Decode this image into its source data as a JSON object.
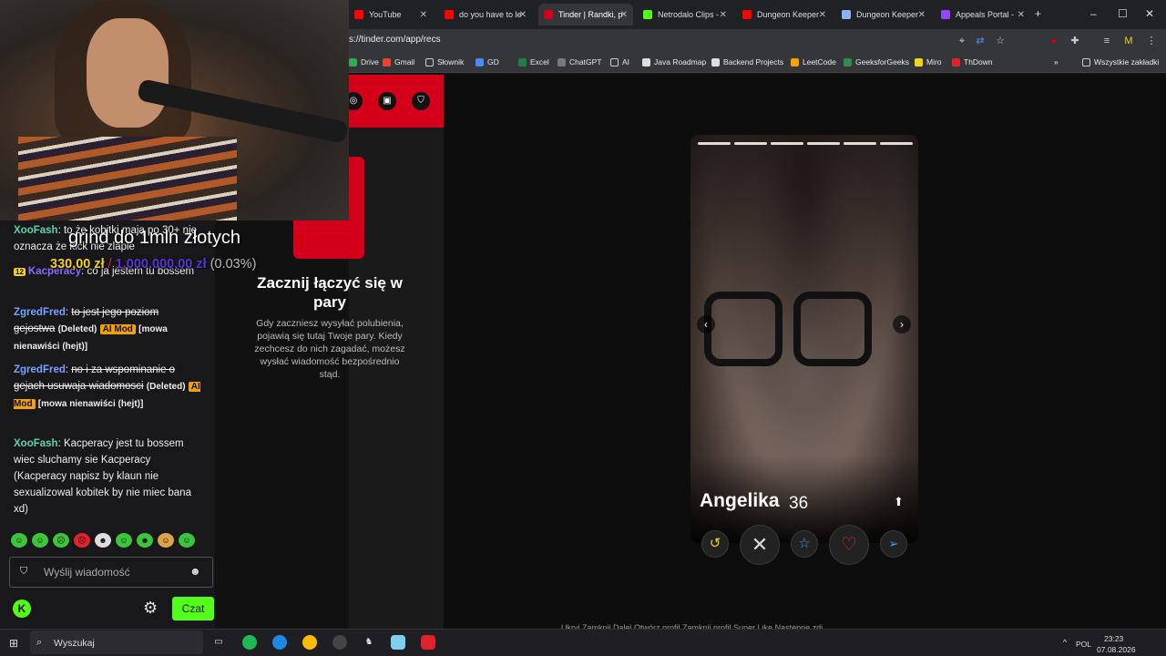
{
  "browser": {
    "tabs": [
      {
        "label": "YouTube",
        "color": "#ff0000"
      },
      {
        "label": "do you have to le",
        "color": "#ff0000"
      },
      {
        "label": "Tinder | Randki, p",
        "color": "#d4001a"
      },
      {
        "label": "Netrodalo Clips -",
        "color": "#53fc18"
      },
      {
        "label": "Dungeon Keeper",
        "color": "#ff0000"
      },
      {
        "label": "Dungeon Keeper",
        "color": "#8ab4f8"
      },
      {
        "label": "Appeals Portal -",
        "color": "#9146ff"
      }
    ],
    "new_tab_icon": "+",
    "url": "s://tinder.com/app/recs",
    "bookmarks": [
      "Drive",
      "Gmail",
      "Słownik",
      "GD",
      "Excel",
      "ChatGPT",
      "AI",
      "Java Roadmap",
      "Backend Projects",
      "LeetCode",
      "GeeksforGeeks",
      "Miro",
      "ThDown"
    ],
    "all_bookmarks": "Wszystkie zakładki",
    "more_bookmarks": "»"
  },
  "tinder": {
    "matches_title": "Zacznij łączyć się w pary",
    "matches_desc": "Gdy zaczniesz wysyłać polubienia, pojawią się tutaj Twoje pary. Kiedy zechcesz do nich zagadać, możesz wysłać wiadomość bezpośrednio stąd.",
    "profile": {
      "name": "Angelika",
      "age": "36"
    },
    "photo_count": 6,
    "shortcuts": "Ukryj    Zamknij    Dalej    Otwórz profil    Zamknij profil    Super Like    Następne zdj..."
  },
  "stream": {
    "goal_text": "grind do 1mln złotych",
    "goal_current": "330,00 zł",
    "goal_slash": "/",
    "goal_target": "1.000.000,00 zł",
    "goal_percent": "(0.03%)",
    "messages": [
      {
        "user": "XooFash",
        "user_color": "#5fd3b0",
        "text": ": to że kobitki mają po 30+ nie oznacza że kick nie zlapie"
      },
      {
        "badge": "12",
        "user": "Kacperacy",
        "user_color": "#8a6bff",
        "text": ": co ja jestem tu bossem"
      },
      {
        "user": "ZgredFred",
        "user_color": "#7aa3ff",
        "text_struck": "to jest jego poziom gejostwa",
        "deleted": "(Deleted)",
        "aimod": "AI Mod",
        "tag": "[mowa nienawiści (hejt)]"
      },
      {
        "user": "ZgredFred",
        "user_color": "#7aa3ff",
        "text_struck": "no i za wspominanie o gejach usuwaja wiadomosci",
        "deleted": "(Deleted)",
        "aimod": "AI Mod",
        "tag": "[mowa nienawiści (hejt)]"
      },
      {
        "user": "XooFash",
        "user_color": "#5fd3b0",
        "text": ": Kacperacy jest tu bossem wiec sluchamy sie Kacperacy (Kacperacy napisz by klaun nie sexualizowal kobitek by nie miec bana xd)"
      }
    ],
    "chat_placeholder": "Wyślij wiadomość",
    "chat_button": "Czat"
  },
  "taskbar": {
    "search": "Wyszukaj",
    "lang": "POL",
    "time": "23:23",
    "date": "07.08.2026"
  }
}
